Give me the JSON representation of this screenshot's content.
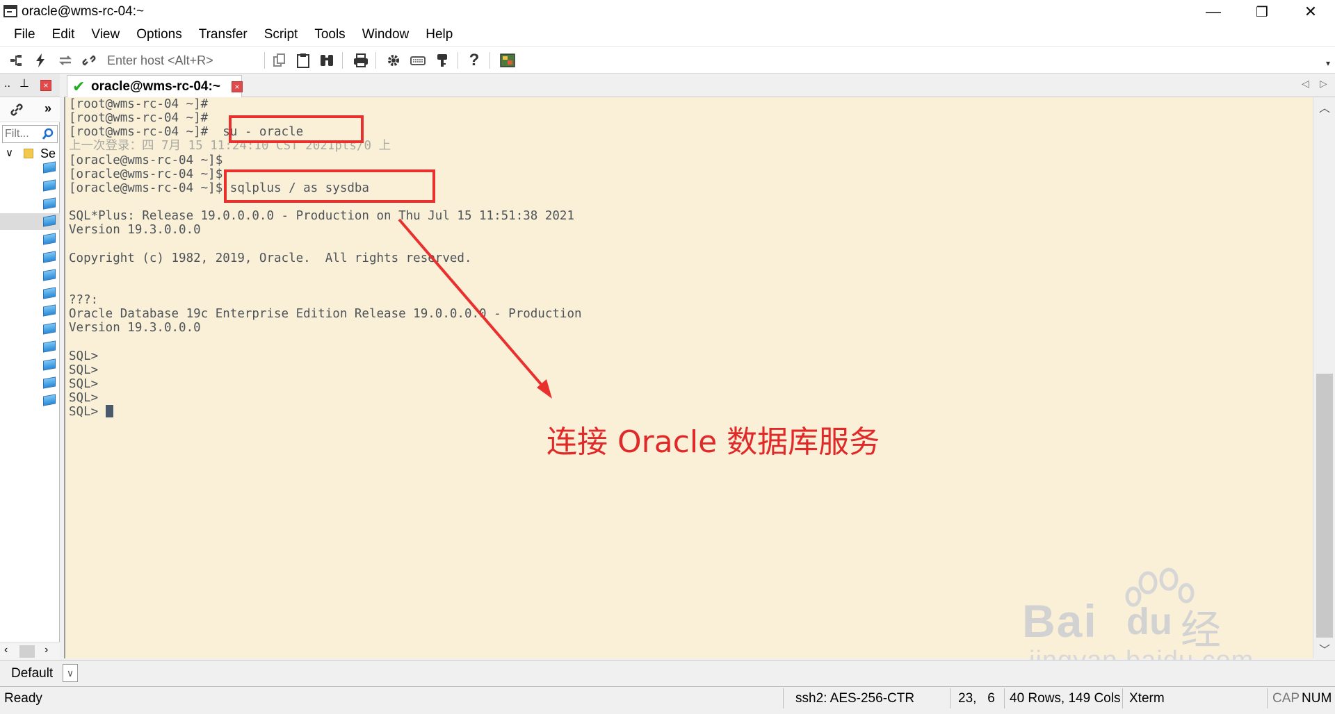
{
  "window": {
    "title": "oracle@wms-rc-04:~",
    "minimize": "—",
    "restore": "❐",
    "close": "✕"
  },
  "menu": [
    "File",
    "Edit",
    "View",
    "Options",
    "Transfer",
    "Script",
    "Tools",
    "Window",
    "Help"
  ],
  "toolbar": {
    "host_placeholder": "Enter host <Alt+R>",
    "icons": [
      "connect-icon",
      "quick-connect-icon",
      "reconnect-icon",
      "disconnect-icon",
      "copy-icon",
      "paste-icon",
      "find-icon",
      "print-icon",
      "settings-icon",
      "keymap-icon",
      "key-icon",
      "help-icon",
      "sftp-icon"
    ]
  },
  "session_panel": {
    "header_label": "..",
    "filter_placeholder": "Filt...",
    "tree_root": "Se",
    "session_count": 14
  },
  "tab": {
    "label": "oracle@wms-rc-04:~",
    "status_icon": "connected-check-icon"
  },
  "terminal": {
    "lines": [
      {
        "text": "[root@wms-rc-04 ~]#",
        "faint": false
      },
      {
        "text": "[root@wms-rc-04 ~]#",
        "faint": false
      },
      {
        "text": "[root@wms-rc-04 ~]#  su - oracle",
        "faint": false
      },
      {
        "text": "上一次登录：四 7月 15 11:24:10 CST 2021pts/0 上",
        "faint": true
      },
      {
        "text": "[oracle@wms-rc-04 ~]$",
        "faint": false
      },
      {
        "text": "[oracle@wms-rc-04 ~]$",
        "faint": false
      },
      {
        "text": "[oracle@wms-rc-04 ~]$ sqlplus / as sysdba",
        "faint": false
      },
      {
        "text": "",
        "faint": false
      },
      {
        "text": "SQL*Plus: Release 19.0.0.0.0 - Production on Thu Jul 15 11:51:38 2021",
        "faint": false
      },
      {
        "text": "Version 19.3.0.0.0",
        "faint": false
      },
      {
        "text": "",
        "faint": false
      },
      {
        "text": "Copyright (c) 1982, 2019, Oracle.  All rights reserved.",
        "faint": false
      },
      {
        "text": "",
        "faint": false
      },
      {
        "text": "",
        "faint": false
      },
      {
        "text": "???:",
        "faint": false
      },
      {
        "text": "Oracle Database 19c Enterprise Edition Release 19.0.0.0.0 - Production",
        "faint": false
      },
      {
        "text": "Version 19.3.0.0.0",
        "faint": false
      },
      {
        "text": "",
        "faint": false
      },
      {
        "text": "SQL>",
        "faint": false
      },
      {
        "text": "SQL>",
        "faint": false
      },
      {
        "text": "SQL>",
        "faint": false
      },
      {
        "text": "SQL>",
        "faint": false
      },
      {
        "text": "SQL> ",
        "faint": false,
        "cursor": true
      }
    ]
  },
  "annotation": {
    "text": "连接 Oracle 数据库服务",
    "color": "#e02a2a"
  },
  "watermark": {
    "brand": "Bai",
    "brand2": "du",
    "cn": "经验",
    "url": "jingyan.baidu.com"
  },
  "bottom": {
    "session_select": "Default"
  },
  "status": {
    "ready": "Ready",
    "cipher": "ssh2: AES-256-CTR",
    "cursor_pos": "23,   6",
    "dims": "40 Rows, 149 Cols",
    "emulation": "Xterm",
    "cap": "CAP",
    "num": "NUM"
  },
  "colors": {
    "terminal_bg": "#faf0d8",
    "terminal_fg": "#4d5358",
    "highlight": "#e8302f"
  }
}
